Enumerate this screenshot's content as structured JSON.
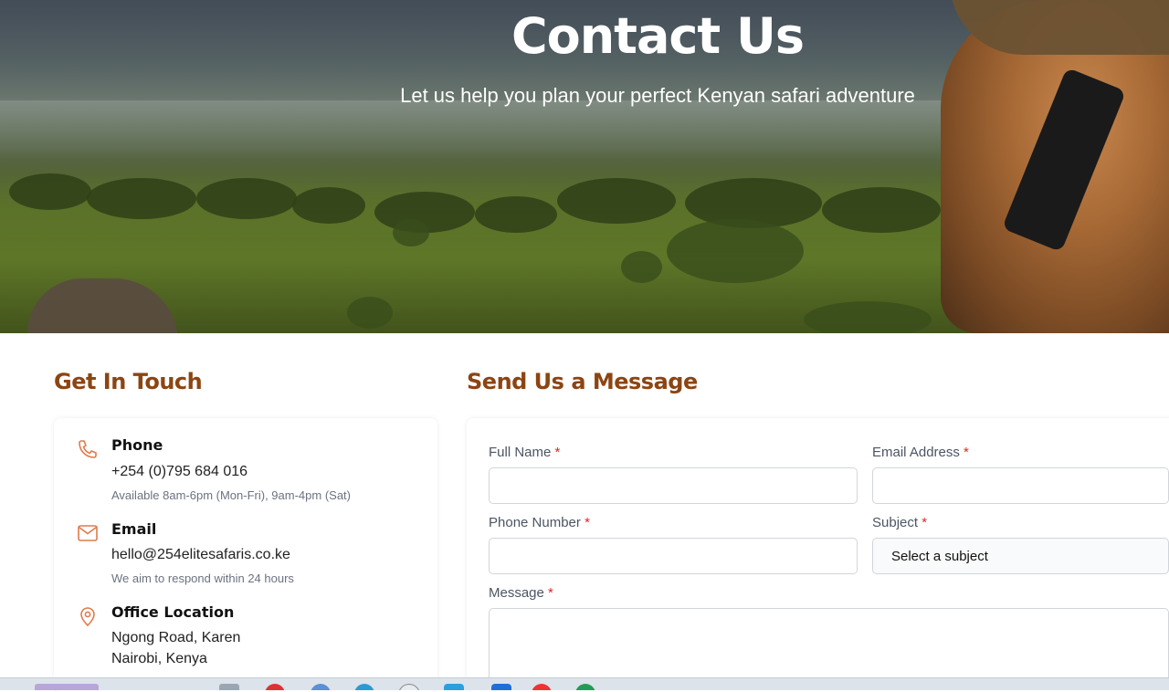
{
  "hero": {
    "title": "Contact Us",
    "subtitle": "Let us help you plan your perfect Kenyan safari adventure"
  },
  "contact": {
    "heading": "Get In Touch",
    "phone": {
      "icon": "phone-icon",
      "label": "Phone",
      "value": "+254 (0)795 684 016",
      "note": "Available 8am-6pm (Mon-Fri), 9am-4pm (Sat)"
    },
    "email": {
      "icon": "mail-icon",
      "label": "Email",
      "value": "hello@254elitesafaris.co.ke",
      "note": "We aim to respond within 24 hours"
    },
    "office": {
      "icon": "map-pin-icon",
      "label": "Office Location",
      "line1": "Ngong Road, Karen",
      "line2": "Nairobi, Kenya"
    }
  },
  "form": {
    "heading": "Send Us a Message",
    "required_mark": "*",
    "full_name": {
      "label": "Full Name",
      "value": ""
    },
    "email": {
      "label": "Email Address",
      "value": ""
    },
    "phone": {
      "label": "Phone Number",
      "value": ""
    },
    "subject": {
      "label": "Subject",
      "selected": "Select a subject"
    },
    "message": {
      "label": "Message",
      "value": ""
    }
  },
  "colors": {
    "accent": "#8b4513",
    "icon": "#e07b4a",
    "required": "#dc2626"
  }
}
